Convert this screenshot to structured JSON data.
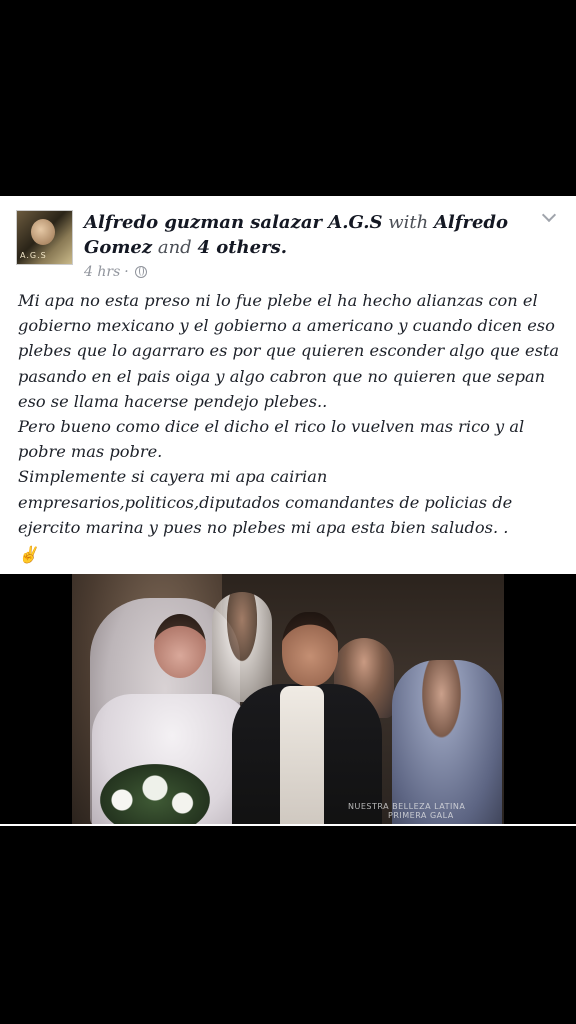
{
  "post": {
    "author": "Alfredo guzman salazar A.G.S",
    "with_word": "with",
    "tagged_name": "Alfredo Gomez",
    "and_word": "and",
    "others": "4 others.",
    "time": "4 hrs",
    "dot": "·",
    "avatar_tag": "A.G.S",
    "paragraphs": [
      "Mi apa no esta preso  ni lo fue plebe el ha hecho alianzas con el gobierno mexicano y el gobierno a americano  y cuando dicen eso plebes que lo agarraro  es por que quieren esconder algo que esta pasando en el pais oiga   y algo cabron que no quieren que sepan eso se llama hacerse pendejo plebes..",
      "Pero bueno como dice el dicho el rico lo vuelven mas rico y al pobre mas pobre.",
      "Simplemente si cayera mi apa cairian empresarios,politicos,diputados  comandantes de policias  de ejercito marina  y pues no plebes mi apa esta bien saludos. ."
    ],
    "emoji": "✌",
    "photo_watermark": [
      "NUESTRA BELLEZA LATINA",
      "PRIMERA GALA"
    ]
  },
  "icons": {
    "menu": "chevron-down-icon",
    "privacy": "globe-icon",
    "emoji": "victory-hand-icon"
  }
}
